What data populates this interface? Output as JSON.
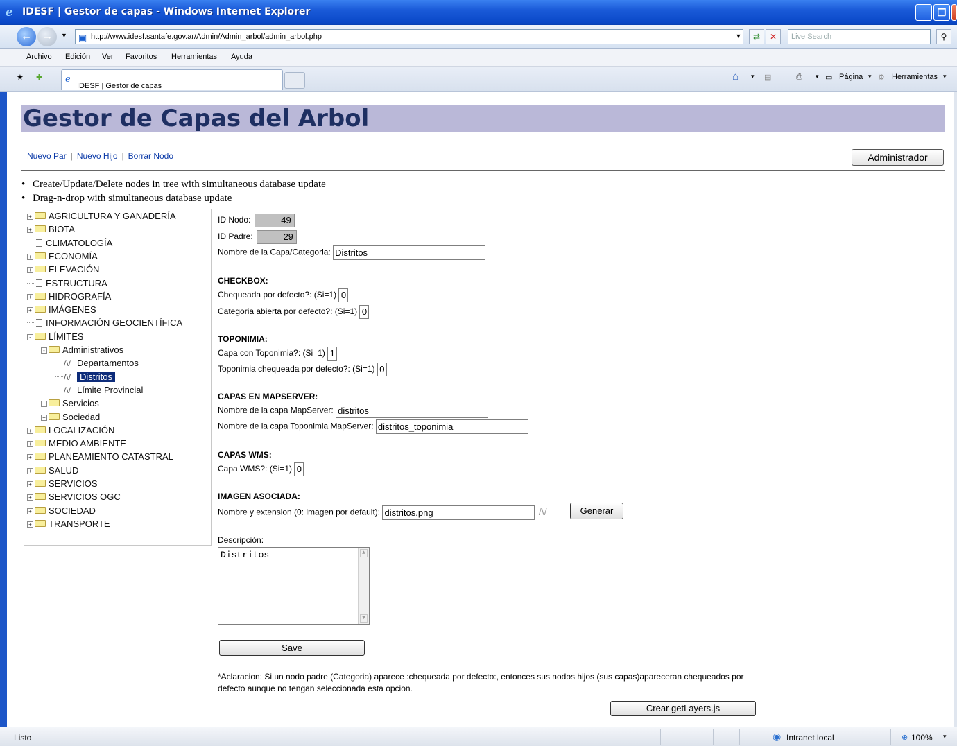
{
  "window": {
    "title": "IDESF | Gestor de capas - Windows Internet Explorer",
    "url": "http://www.idesf.santafe.gov.ar/Admin/Admin_arbol/admin_arbol.php",
    "search_placeholder": "Live Search",
    "tab_title": "IDESF | Gestor de capas",
    "menu": [
      "Archivo",
      "Edición",
      "Ver",
      "Favoritos",
      "Herramientas",
      "Ayuda"
    ],
    "commands": {
      "page": "Página",
      "tools": "Herramientas"
    }
  },
  "page": {
    "title": "Gestor de Capas del Arbol",
    "links": [
      "Nuevo Par",
      "Nuevo Hijo",
      "Borrar Nodo"
    ],
    "admin_button": "Administrador",
    "bullets": [
      "Create/Update/Delete nodes in tree with simultaneous database update",
      "Drag-n-drop with simultaneous database update"
    ]
  },
  "tree": [
    {
      "label": "AGRICULTURA Y GANADERÍA",
      "level": 0,
      "kind": "folder",
      "expand": "+"
    },
    {
      "label": "BIOTA",
      "level": 0,
      "kind": "folder",
      "expand": "+"
    },
    {
      "label": "CLIMATOLOGÍA",
      "level": 0,
      "kind": "leaf",
      "expand": ""
    },
    {
      "label": "ECONOMÍA",
      "level": 0,
      "kind": "folder",
      "expand": "+"
    },
    {
      "label": "ELEVACIÓN",
      "level": 0,
      "kind": "folder",
      "expand": "+"
    },
    {
      "label": "ESTRUCTURA",
      "level": 0,
      "kind": "leaf",
      "expand": ""
    },
    {
      "label": "HIDROGRAFÍA",
      "level": 0,
      "kind": "folder",
      "expand": "+"
    },
    {
      "label": "IMÁGENES",
      "level": 0,
      "kind": "folder",
      "expand": "+"
    },
    {
      "label": "INFORMACIÓN GEOCIENTÍFICA",
      "level": 0,
      "kind": "leaf",
      "expand": ""
    },
    {
      "label": "LÍMITES",
      "level": 0,
      "kind": "folder",
      "expand": "-"
    },
    {
      "label": "Administrativos",
      "level": 1,
      "kind": "folder",
      "expand": "-"
    },
    {
      "label": "Departamentos",
      "level": 2,
      "kind": "layer",
      "expand": ""
    },
    {
      "label": "Distritos",
      "level": 2,
      "kind": "layer",
      "expand": "",
      "selected": true
    },
    {
      "label": "Límite Provincial",
      "level": 2,
      "kind": "layer",
      "expand": ""
    },
    {
      "label": "Servicios",
      "level": 1,
      "kind": "folder",
      "expand": "+"
    },
    {
      "label": "Sociedad",
      "level": 1,
      "kind": "folder",
      "expand": "+"
    },
    {
      "label": "LOCALIZACIÓN",
      "level": 0,
      "kind": "folder",
      "expand": "+"
    },
    {
      "label": "MEDIO AMBIENTE",
      "level": 0,
      "kind": "folder",
      "expand": "+"
    },
    {
      "label": "PLANEAMIENTO CATASTRAL",
      "level": 0,
      "kind": "folder",
      "expand": "+"
    },
    {
      "label": "SALUD",
      "level": 0,
      "kind": "folder",
      "expand": "+"
    },
    {
      "label": "SERVICIOS",
      "level": 0,
      "kind": "folder",
      "expand": "+"
    },
    {
      "label": "SERVICIOS OGC",
      "level": 0,
      "kind": "folder",
      "expand": "+"
    },
    {
      "label": "SOCIEDAD",
      "level": 0,
      "kind": "folder",
      "expand": "+"
    },
    {
      "label": "TRANSPORTE",
      "level": 0,
      "kind": "folder",
      "expand": "+"
    }
  ],
  "form": {
    "id_nodo_label": "ID Nodo:",
    "id_nodo": "49",
    "id_padre_label": "ID Padre:",
    "id_padre": "29",
    "nombre_label": "Nombre de la Capa/Categoria:",
    "nombre": "Distritos",
    "checkbox_title": "CHECKBOX:",
    "chequeada_label": "Chequeada por defecto?: (Si=1)",
    "chequeada": "0",
    "abierta_label": "Categoria abierta por defecto?: (Si=1)",
    "abierta": "0",
    "toponimia_title": "TOPONIMIA:",
    "capa_topo_label": "Capa con Toponimia?: (Si=1)",
    "capa_topo": "1",
    "topo_cheq_label": "Toponimia chequeada por defecto?: (Si=1)",
    "topo_cheq": "0",
    "mapserver_title": "CAPAS EN MAPSERVER:",
    "ms_capa_label": "Nombre de la capa MapServer:",
    "ms_capa": "distritos",
    "ms_topo_label": "Nombre de la capa Toponimia MapServer:",
    "ms_topo": "distritos_toponimia",
    "wms_title": "CAPAS WMS:",
    "wms_label": "Capa WMS?: (Si=1)",
    "wms": "0",
    "imagen_title": "IMAGEN ASOCIADA:",
    "imagen_label": "Nombre y extension (0: imagen por default):",
    "imagen": "distritos.png",
    "generar_button": "Generar",
    "descripcion_label": "Descripción:",
    "descripcion": "Distritos",
    "save_button": "Save",
    "note": "*Aclaracion: Si un nodo padre (Categoria) aparece :chequeada por defecto:, entonces sus nodos hijos (sus capas)apareceran chequeados por defecto aunque no tengan seleccionada esta opcion.",
    "crear_button": "Crear getLayers.js"
  },
  "status": {
    "text": "Listo",
    "zone": "Intranet local",
    "zoom": "100%"
  }
}
